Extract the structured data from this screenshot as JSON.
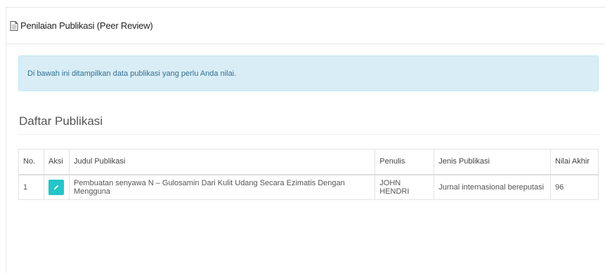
{
  "panel": {
    "title": "Penilaian Publikasi (Peer Review)",
    "title_icon": "document-icon"
  },
  "alert": {
    "text": "Di bawah ini ditampilkan data publikasi yang perlu Anda nilai."
  },
  "section": {
    "title": "Daftar Publikasi"
  },
  "table": {
    "headers": {
      "no": "No.",
      "aksi": "Aksi",
      "judul": "Judul Publikasi",
      "penulis": "Penulis",
      "jenis": "Jenis Publikasi",
      "nilai": "Nilai Akhir"
    },
    "rows": [
      {
        "no": "1",
        "action_icon": "pencil-icon",
        "judul": "Pembuatan senyawa N – Gulosamin Dari Kulit Udang Secara Ezimatis Dengan Mengguna",
        "penulis": "JOHN HENDRI",
        "jenis": "Jurnal internasional bereputasi",
        "nilai": "96"
      }
    ]
  },
  "colors": {
    "alert_bg": "#d9edf7",
    "alert_text": "#31708f",
    "edit_button": "#23c6c8"
  }
}
